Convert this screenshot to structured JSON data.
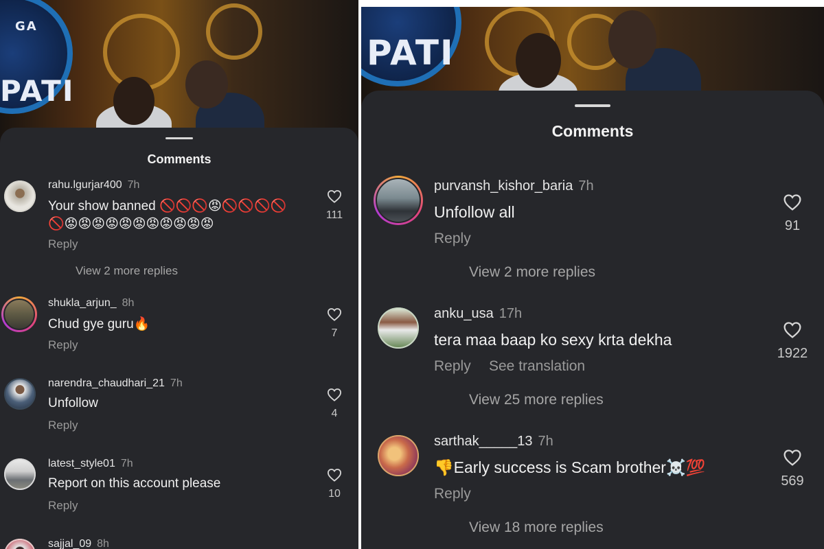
{
  "left": {
    "title": "Comments",
    "comments": [
      {
        "user": "rahu.lgurjar400",
        "time": "7h",
        "text": "Your show banned 🚫🚫🚫😡🚫🚫🚫🚫",
        "text2": "🚫😡😡😡😡😡😡😡😡😡😡😡",
        "reply": "Reply",
        "likes": "111",
        "more": "View 2 more replies"
      },
      {
        "user": "shukla_arjun_",
        "time": "8h",
        "text": "Chud gye guru🔥",
        "reply": "Reply",
        "likes": "7"
      },
      {
        "user": "narendra_chaudhari_21",
        "time": "7h",
        "text": "Unfollow",
        "reply": "Reply",
        "likes": "4"
      },
      {
        "user": "latest_style01",
        "time": "7h",
        "text": "Report on this account please",
        "reply": "Reply",
        "likes": "10"
      },
      {
        "user": "sajjal_09",
        "time": "8h"
      }
    ],
    "video_logo_text": "PATI",
    "video_logo_top": "GA"
  },
  "right": {
    "title": "Comments",
    "comments": [
      {
        "user": "purvansh_kishor_baria",
        "time": "7h",
        "text": "Unfollow all",
        "reply": "Reply",
        "likes": "91",
        "more": "View 2 more replies"
      },
      {
        "user": "anku_usa",
        "time": "17h",
        "text": "tera maa baap ko sexy krta dekha",
        "reply": "Reply",
        "translate": "See translation",
        "likes": "1922",
        "more": "View 25 more replies"
      },
      {
        "user": "sarthak_____13",
        "time": "7h",
        "text": "👎Early success is Scam brother☠️💯",
        "reply": "Reply",
        "likes": "569",
        "more": "View 18 more replies"
      }
    ],
    "video_logo_text": "PATI"
  },
  "colors": {
    "sheet": "#26272b",
    "text": "#f0f0f0",
    "muted": "#9a9a9a",
    "logo_blue": "#1f6fb5",
    "gold": "#c7902e"
  },
  "icons": [
    "heart-icon",
    "avatar",
    "drag-handle"
  ]
}
